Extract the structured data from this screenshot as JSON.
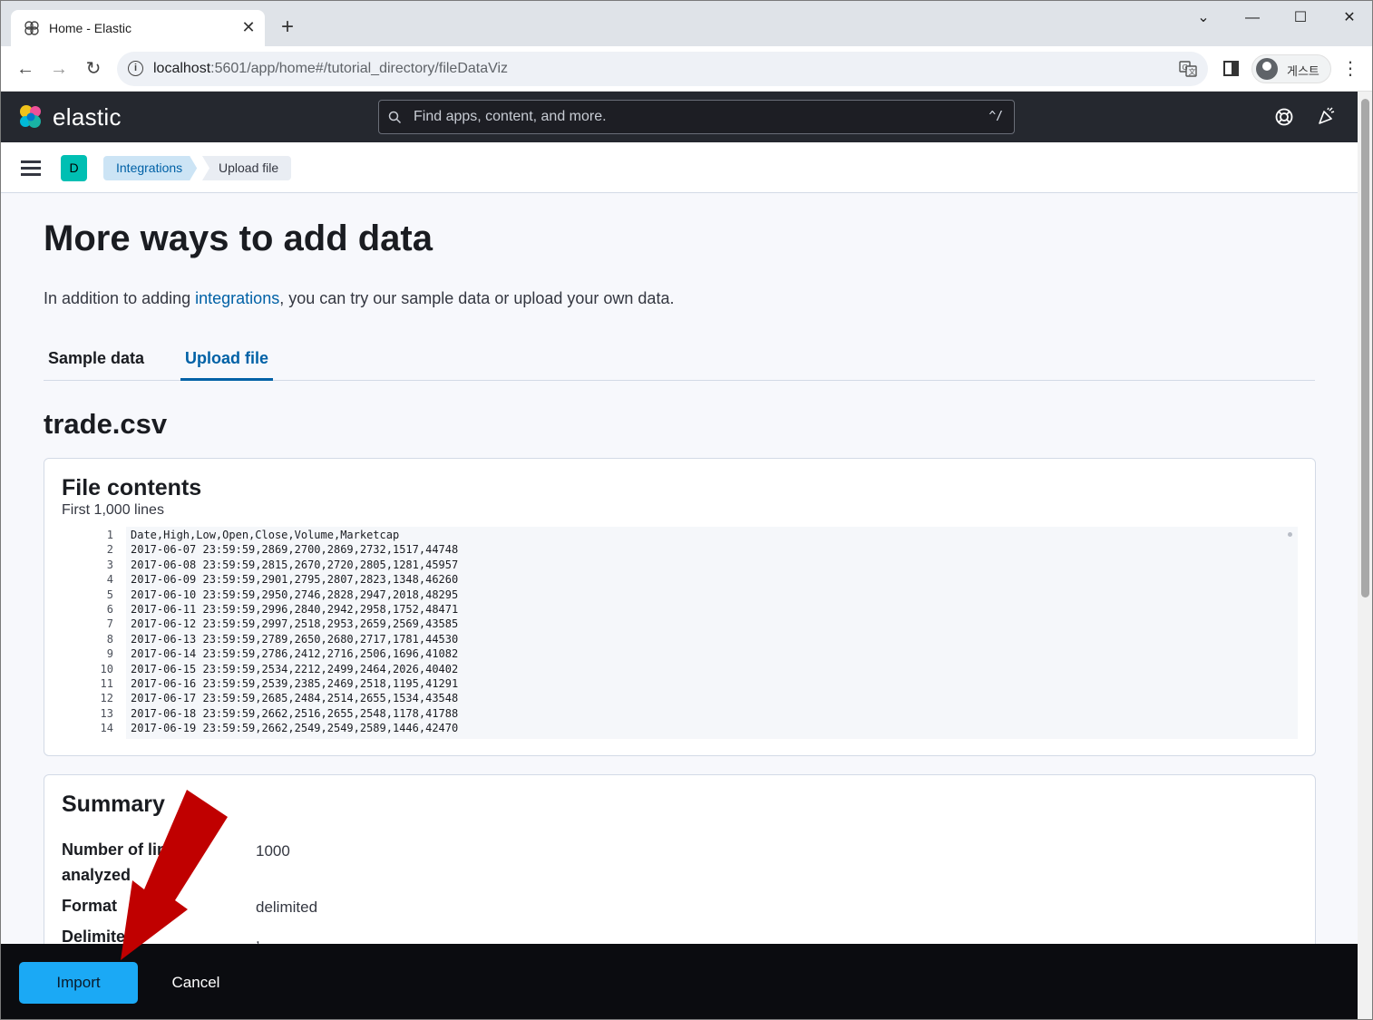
{
  "browser": {
    "tab_title": "Home - Elastic",
    "tab_close": "✕",
    "new_tab": "+",
    "window_controls": {
      "chevron": "⌄",
      "minimize": "—",
      "maximize": "☐",
      "close": "✕"
    },
    "nav": {
      "back": "←",
      "forward": "→",
      "reload": "↻"
    },
    "url_host": "localhost",
    "url_path": ":5601/app/home#/tutorial_directory/fileDataViz",
    "profile_label": "게스트",
    "menu": "⋮"
  },
  "kibana": {
    "brand": "elastic",
    "search_placeholder": "Find apps, content, and more.",
    "search_shortcut": "^/",
    "space_initial": "D",
    "breadcrumbs": [
      "Integrations",
      "Upload file"
    ]
  },
  "page": {
    "title": "More ways to add data",
    "description_prefix": "In addition to adding ",
    "description_link": "integrations",
    "description_suffix": ", you can try our sample data or upload your own data.",
    "tabs": [
      {
        "label": "Sample data",
        "active": false
      },
      {
        "label": "Upload file",
        "active": true
      }
    ],
    "file_name": "trade.csv"
  },
  "file_contents": {
    "title": "File contents",
    "subtitle": "First 1,000 lines",
    "lines": [
      "Date,High,Low,Open,Close,Volume,Marketcap",
      "2017-06-07 23:59:59,2869,2700,2869,2732,1517,44748",
      "2017-06-08 23:59:59,2815,2670,2720,2805,1281,45957",
      "2017-06-09 23:59:59,2901,2795,2807,2823,1348,46260",
      "2017-06-10 23:59:59,2950,2746,2828,2947,2018,48295",
      "2017-06-11 23:59:59,2996,2840,2942,2958,1752,48471",
      "2017-06-12 23:59:59,2997,2518,2953,2659,2569,43585",
      "2017-06-13 23:59:59,2789,2650,2680,2717,1781,44530",
      "2017-06-14 23:59:59,2786,2412,2716,2506,1696,41082",
      "2017-06-15 23:59:59,2534,2212,2499,2464,2026,40402",
      "2017-06-16 23:59:59,2539,2385,2469,2518,1195,41291",
      "2017-06-17 23:59:59,2685,2484,2514,2655,1534,43548",
      "2017-06-18 23:59:59,2662,2516,2655,2548,1178,41788",
      "2017-06-19 23:59:59,2662,2549,2549,2589,1446,42470"
    ],
    "line_numbers": [
      "1",
      "2",
      "3",
      "4",
      "5",
      "6",
      "7",
      "8",
      "9",
      "10",
      "11",
      "12",
      "13",
      "14"
    ]
  },
  "summary": {
    "title": "Summary",
    "rows": [
      {
        "label_line1": "Number of lines",
        "label_line2": "analyzed",
        "value": "1000"
      },
      {
        "label_line1": "Format",
        "label_line2": "",
        "value": "delimited"
      },
      {
        "label_line1": "Delimiter",
        "label_line2": "",
        "value": ","
      }
    ]
  },
  "actions": {
    "import_label": "Import",
    "cancel_label": "Cancel"
  },
  "colors": {
    "accent": "#0061a6",
    "import_button": "#1ba9f5",
    "annotation_arrow": "#c00000"
  }
}
